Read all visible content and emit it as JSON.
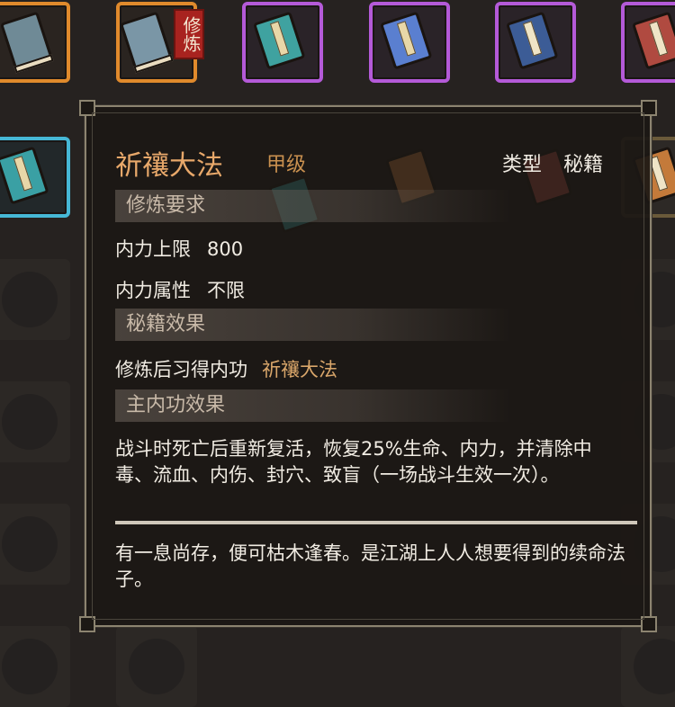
{
  "inventory": {
    "badge_text": "修炼"
  },
  "tooltip": {
    "name": "祈禳大法",
    "grade": "甲级",
    "type_label": "类型",
    "type_value": "秘籍",
    "req_header": "修炼要求",
    "req_rows": [
      {
        "label": "内力上限",
        "value": "800"
      },
      {
        "label": "内力属性",
        "value": "不限"
      }
    ],
    "effect_header": "秘籍效果",
    "effect_label": "修炼后习得内功",
    "effect_value": "祈禳大法",
    "main_header": "主内功效果",
    "main_text": "战斗时死亡后重新复活，恢复25%生命、内力，并清除中毒、流血、内伤、封穴、致盲（一场战斗生效一次）。",
    "flavor_text": "有一息尚存，便可枯木逢春。是江湖上人人想要得到的续命法子。"
  }
}
